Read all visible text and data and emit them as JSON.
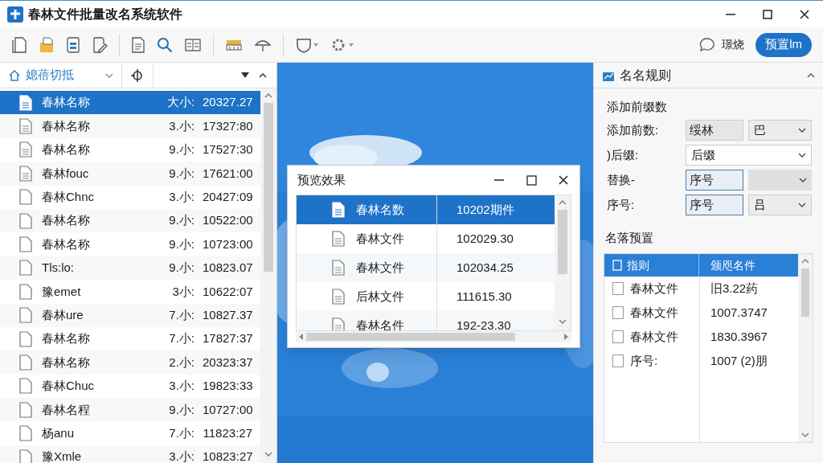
{
  "window": {
    "title": "春林文件批量改名系统软件"
  },
  "toolbar": {
    "feedback_label": "璟烧",
    "preset_button": "预置lm"
  },
  "file_panel": {
    "view_selector": "媳蓓切抵",
    "rows": [
      {
        "name": "春林名称",
        "size": "大小:",
        "time": "20327.27",
        "selected": true
      },
      {
        "name": "春林名称",
        "size": "3.小:",
        "time": "17327:80",
        "selected": false
      },
      {
        "name": "春林名称",
        "size": "9.小:",
        "time": "17527:30",
        "selected": false
      },
      {
        "name": "春林fouc",
        "size": "9.小:",
        "time": "17621:00",
        "selected": false
      },
      {
        "name": "春林Chnc",
        "size": "3.小:",
        "time": "20427:09",
        "selected": false
      },
      {
        "name": "春林名称",
        "size": "9.小:",
        "time": "10522:00",
        "selected": false
      },
      {
        "name": "春林名称",
        "size": "9.小:",
        "time": "10723:00",
        "selected": false
      },
      {
        "name": "Tls:lo:",
        "size": "9.小:",
        "time": "10823.07",
        "selected": false
      },
      {
        "name": "豫emet",
        "size": "3小:",
        "time": "10622:07",
        "selected": false
      },
      {
        "name": "春林ure",
        "size": "7.小:",
        "time": "10827.37",
        "selected": false
      },
      {
        "name": "春林名称",
        "size": "7.小:",
        "time": "17827:37",
        "selected": false
      },
      {
        "name": "春林名称",
        "size": "2.小:",
        "time": "20323:37",
        "selected": false
      },
      {
        "name": "春林Chuc",
        "size": "3.小:",
        "time": "19823:33",
        "selected": false
      },
      {
        "name": "春林名程",
        "size": "9.小:",
        "time": "10727:00",
        "selected": false
      },
      {
        "name": "杨anu",
        "size": "7.小:",
        "time": "11823:27",
        "selected": false
      },
      {
        "name": "豫Xmle",
        "size": "3.小:",
        "time": "10823:27",
        "selected": false
      }
    ]
  },
  "preview_dialog": {
    "title": "预览效果",
    "rows": [
      {
        "name": "春林名数",
        "value": "10202期件",
        "selected": true
      },
      {
        "name": "春林文件",
        "value": "102029.30",
        "selected": false
      },
      {
        "name": "春林文件",
        "value": "102034.25",
        "selected": false
      },
      {
        "name": "后林文件",
        "value": "111615.30",
        "selected": false
      },
      {
        "name": "春林名件",
        "value": "192-23.30",
        "selected": false
      }
    ]
  },
  "rules_panel": {
    "title": "名名规则",
    "section": "添加前缀数",
    "fields": [
      {
        "label": "添加前数:",
        "kind": "pair",
        "value": "绥林",
        "option": "巴",
        "focused": false
      },
      {
        "label": ")后缀:",
        "kind": "wide",
        "value": "后缀"
      },
      {
        "label": "替换-",
        "kind": "pair",
        "value": "序号",
        "focused": true
      },
      {
        "label": "序号:",
        "kind": "pair",
        "value": "序号",
        "option": "吕",
        "focused": true
      }
    ],
    "preset_title": "名落预置",
    "columns": [
      "指则",
      "颁咫名件"
    ],
    "select_all_checked": false,
    "rows": [
      {
        "name": "春林文件",
        "value": "旧3.22药",
        "checked": false
      },
      {
        "name": "春林文件",
        "value": "1007.3747",
        "checked": false
      },
      {
        "name": "春林文件",
        "value": "1830.3967",
        "checked": false
      },
      {
        "name": "序号:",
        "value": "1007 (2)朋",
        "checked": false
      }
    ]
  }
}
